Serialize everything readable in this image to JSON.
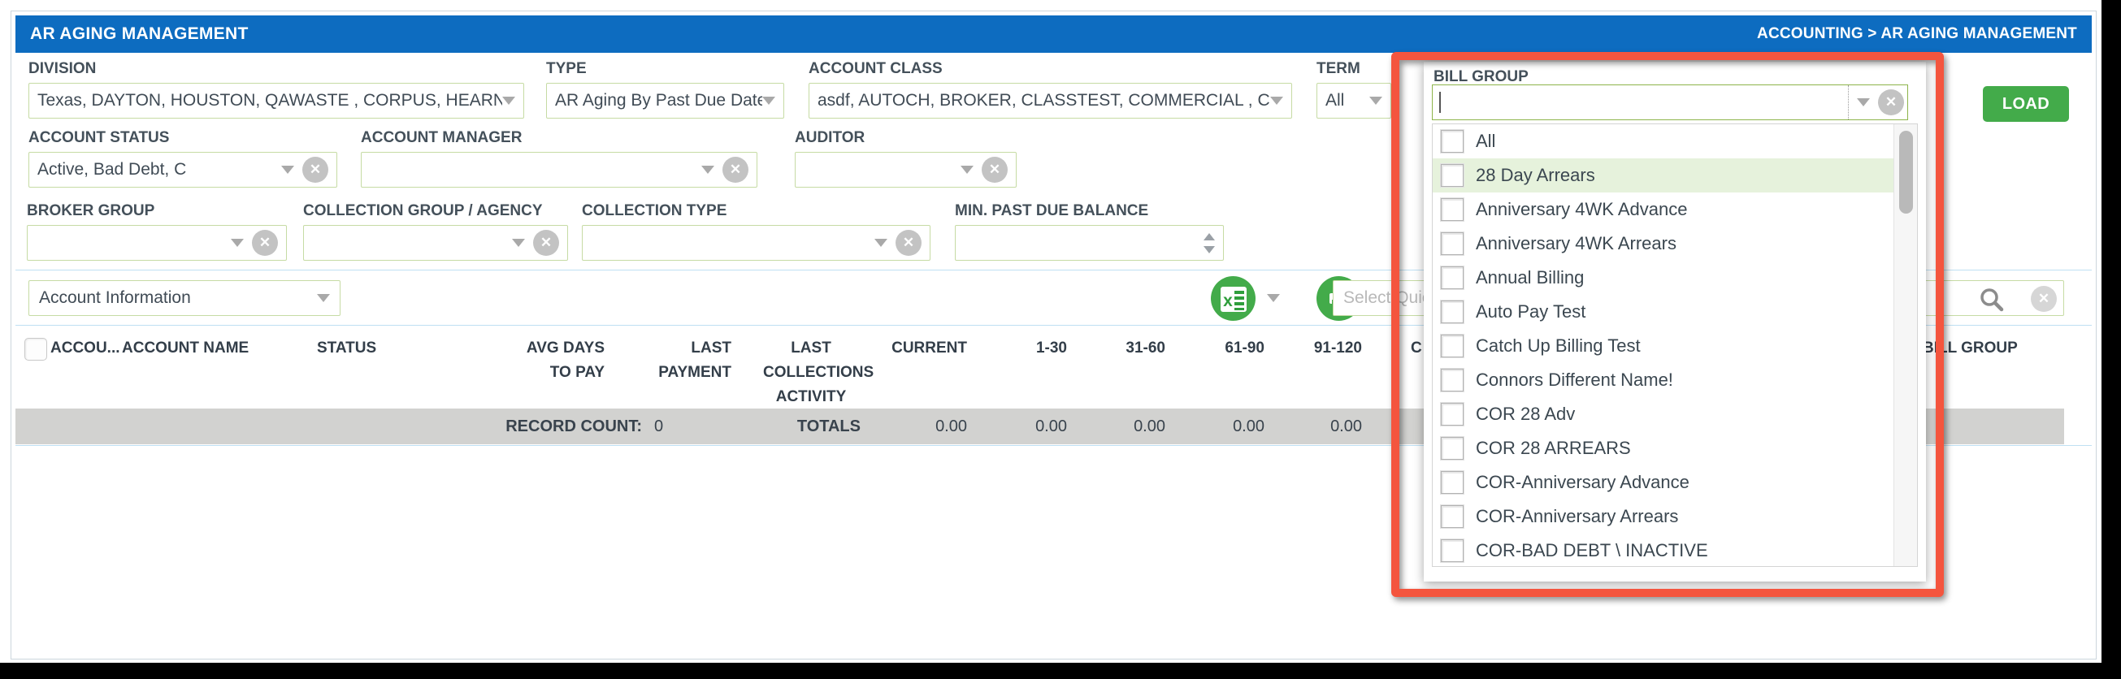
{
  "header": {
    "title": "AR AGING MANAGEMENT",
    "breadcrumb": "ACCOUNTING > AR AGING MANAGEMENT"
  },
  "filters": {
    "division": {
      "label": "DIVISION",
      "value": "Texas, DAYTON, HOUSTON, QAWASTE , CORPUS, HEARNE, H"
    },
    "type": {
      "label": "TYPE",
      "value": "AR Aging By Past Due Date"
    },
    "account_class": {
      "label": "ACCOUNT CLASS",
      "value": "asdf, AUTOCH, BROKER, CLASSTEST, COMMERCIAL , Connors"
    },
    "term": {
      "label": "TERM",
      "value": "All"
    },
    "account_status": {
      "label": "ACCOUNT STATUS",
      "value": "Active, Bad Debt, C"
    },
    "account_manager": {
      "label": "ACCOUNT MANAGER",
      "value": ""
    },
    "auditor": {
      "label": "AUDITOR",
      "value": ""
    },
    "broker_group": {
      "label": "BROKER GROUP",
      "value": ""
    },
    "collection_group_agency": {
      "label": "COLLECTION GROUP / AGENCY",
      "value": ""
    },
    "collection_type": {
      "label": "COLLECTION TYPE",
      "value": ""
    },
    "min_past_due_balance": {
      "label": "MIN. PAST DUE BALANCE",
      "value": ""
    }
  },
  "actions": {
    "load": "LOAD"
  },
  "toolbar": {
    "view_selector": "Account Information",
    "quick_filter_placeholder": "Select Quic",
    "excel_icon": "excel-export-icon",
    "print_icon": "print-icon",
    "search_icon": "search-icon"
  },
  "grid": {
    "columns": {
      "account_number": "ACCOU...",
      "account_name": "ACCOUNT NAME",
      "status": "STATUS",
      "avg_days_l1": "AVG DAYS",
      "avg_days_l2": "TO PAY",
      "last_payment_l1": "LAST",
      "last_payment_l2": "PAYMENT",
      "last_coll_l1": "LAST",
      "last_coll_l2": "COLLECTIONS",
      "last_coll_l3": "ACTIVITY",
      "current": "CURRENT",
      "bucket_1_30": "1-30",
      "bucket_31_60": "31-60",
      "bucket_61_90": "61-90",
      "bucket_91_120": "91-120",
      "partial_hidden": "C",
      "bill_group": "BILL GROUP"
    },
    "totals": {
      "record_count_label": "RECORD COUNT:",
      "record_count": "0",
      "totals_label": "TOTALS",
      "values": [
        "0.00",
        "0.00",
        "0.00",
        "0.00",
        "0.00"
      ]
    }
  },
  "bill_group": {
    "label": "BILL GROUP",
    "value": "",
    "highlighted_item": "28 Day Arrears",
    "items": [
      {
        "label": "All",
        "checked": false
      },
      {
        "label": "28 Day Arrears",
        "checked": false
      },
      {
        "label": "Anniversary 4WK Advance",
        "checked": false
      },
      {
        "label": "Anniversary 4WK Arrears",
        "checked": false
      },
      {
        "label": "Annual Billing",
        "checked": false
      },
      {
        "label": "Auto Pay Test",
        "checked": false
      },
      {
        "label": "Catch Up Billing Test",
        "checked": false
      },
      {
        "label": "Connors Different Name!",
        "checked": false
      },
      {
        "label": "COR 28 Adv",
        "checked": false
      },
      {
        "label": "COR 28 ARREARS",
        "checked": false
      },
      {
        "label": "COR-Anniversary Advance",
        "checked": false
      },
      {
        "label": "COR-Anniversary Arrears",
        "checked": false
      },
      {
        "label": "COR-BAD DEBT \\ INACTIVE",
        "checked": false
      }
    ]
  },
  "colors": {
    "header_blue": "#0d6cc0",
    "accent_green": "#43ab4a",
    "field_border_green": "#c6dba4",
    "annotation_red": "#f4553e",
    "hover_green": "#e6f2dc",
    "totals_gray": "#d2d2d0"
  }
}
